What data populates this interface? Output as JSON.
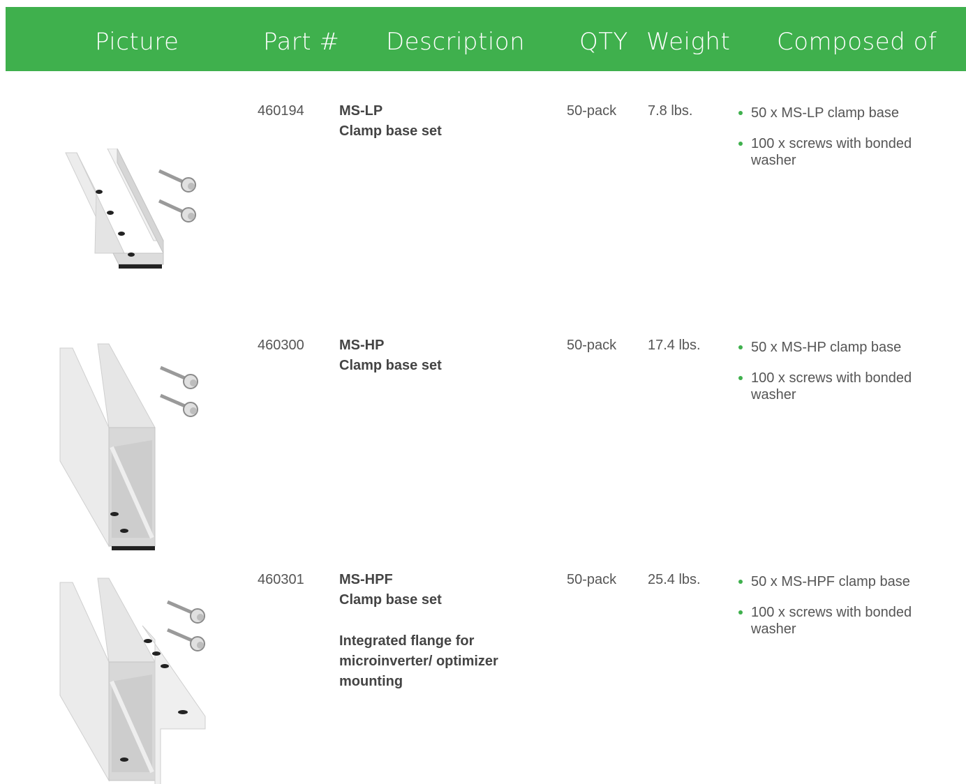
{
  "colors": {
    "header_bg": "#3fb04d",
    "bullet": "#3fb04d",
    "text": "#555555"
  },
  "header": {
    "picture": "Picture",
    "part": "Part #",
    "description": "Description",
    "qty": "QTY",
    "weight": "Weight",
    "composed": "Composed of"
  },
  "rows": [
    {
      "part": "460194",
      "desc_title": "MS-LP",
      "desc_sub": "Clamp base set",
      "desc_extra": "",
      "qty": "50-pack",
      "weight": "7.8 lbs.",
      "composed": [
        "50 x MS-LP clamp base",
        "100 x screws with bonded washer"
      ]
    },
    {
      "part": "460300",
      "desc_title": "MS-HP",
      "desc_sub": "Clamp base set",
      "desc_extra": "",
      "qty": "50-pack",
      "weight": "17.4 lbs.",
      "composed": [
        "50 x MS-HP clamp base",
        "100 x screws with bonded washer"
      ]
    },
    {
      "part": "460301",
      "desc_title": "MS-HPF",
      "desc_sub": "Clamp base set",
      "desc_extra": "Integrated flange for microinverter/ optimizer mounting",
      "qty": "50-pack",
      "weight": "25.4 lbs.",
      "composed": [
        "50 x MS-HPF clamp base",
        "100 x screws with bonded washer"
      ]
    }
  ]
}
